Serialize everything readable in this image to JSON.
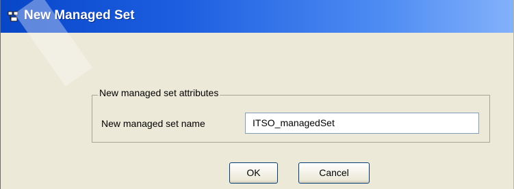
{
  "window": {
    "title": "New Managed Set",
    "icon": "managed-set-icon"
  },
  "group": {
    "legend": "New managed set attributes",
    "name_label": "New managed set name",
    "name_value": "ITSO_managedSet"
  },
  "buttons": {
    "ok_label": "OK",
    "cancel_label": "Cancel"
  },
  "colors": {
    "titlebar_start": "#0846c8",
    "titlebar_end": "#84b1fb",
    "dialog_background": "#ece9d8"
  }
}
